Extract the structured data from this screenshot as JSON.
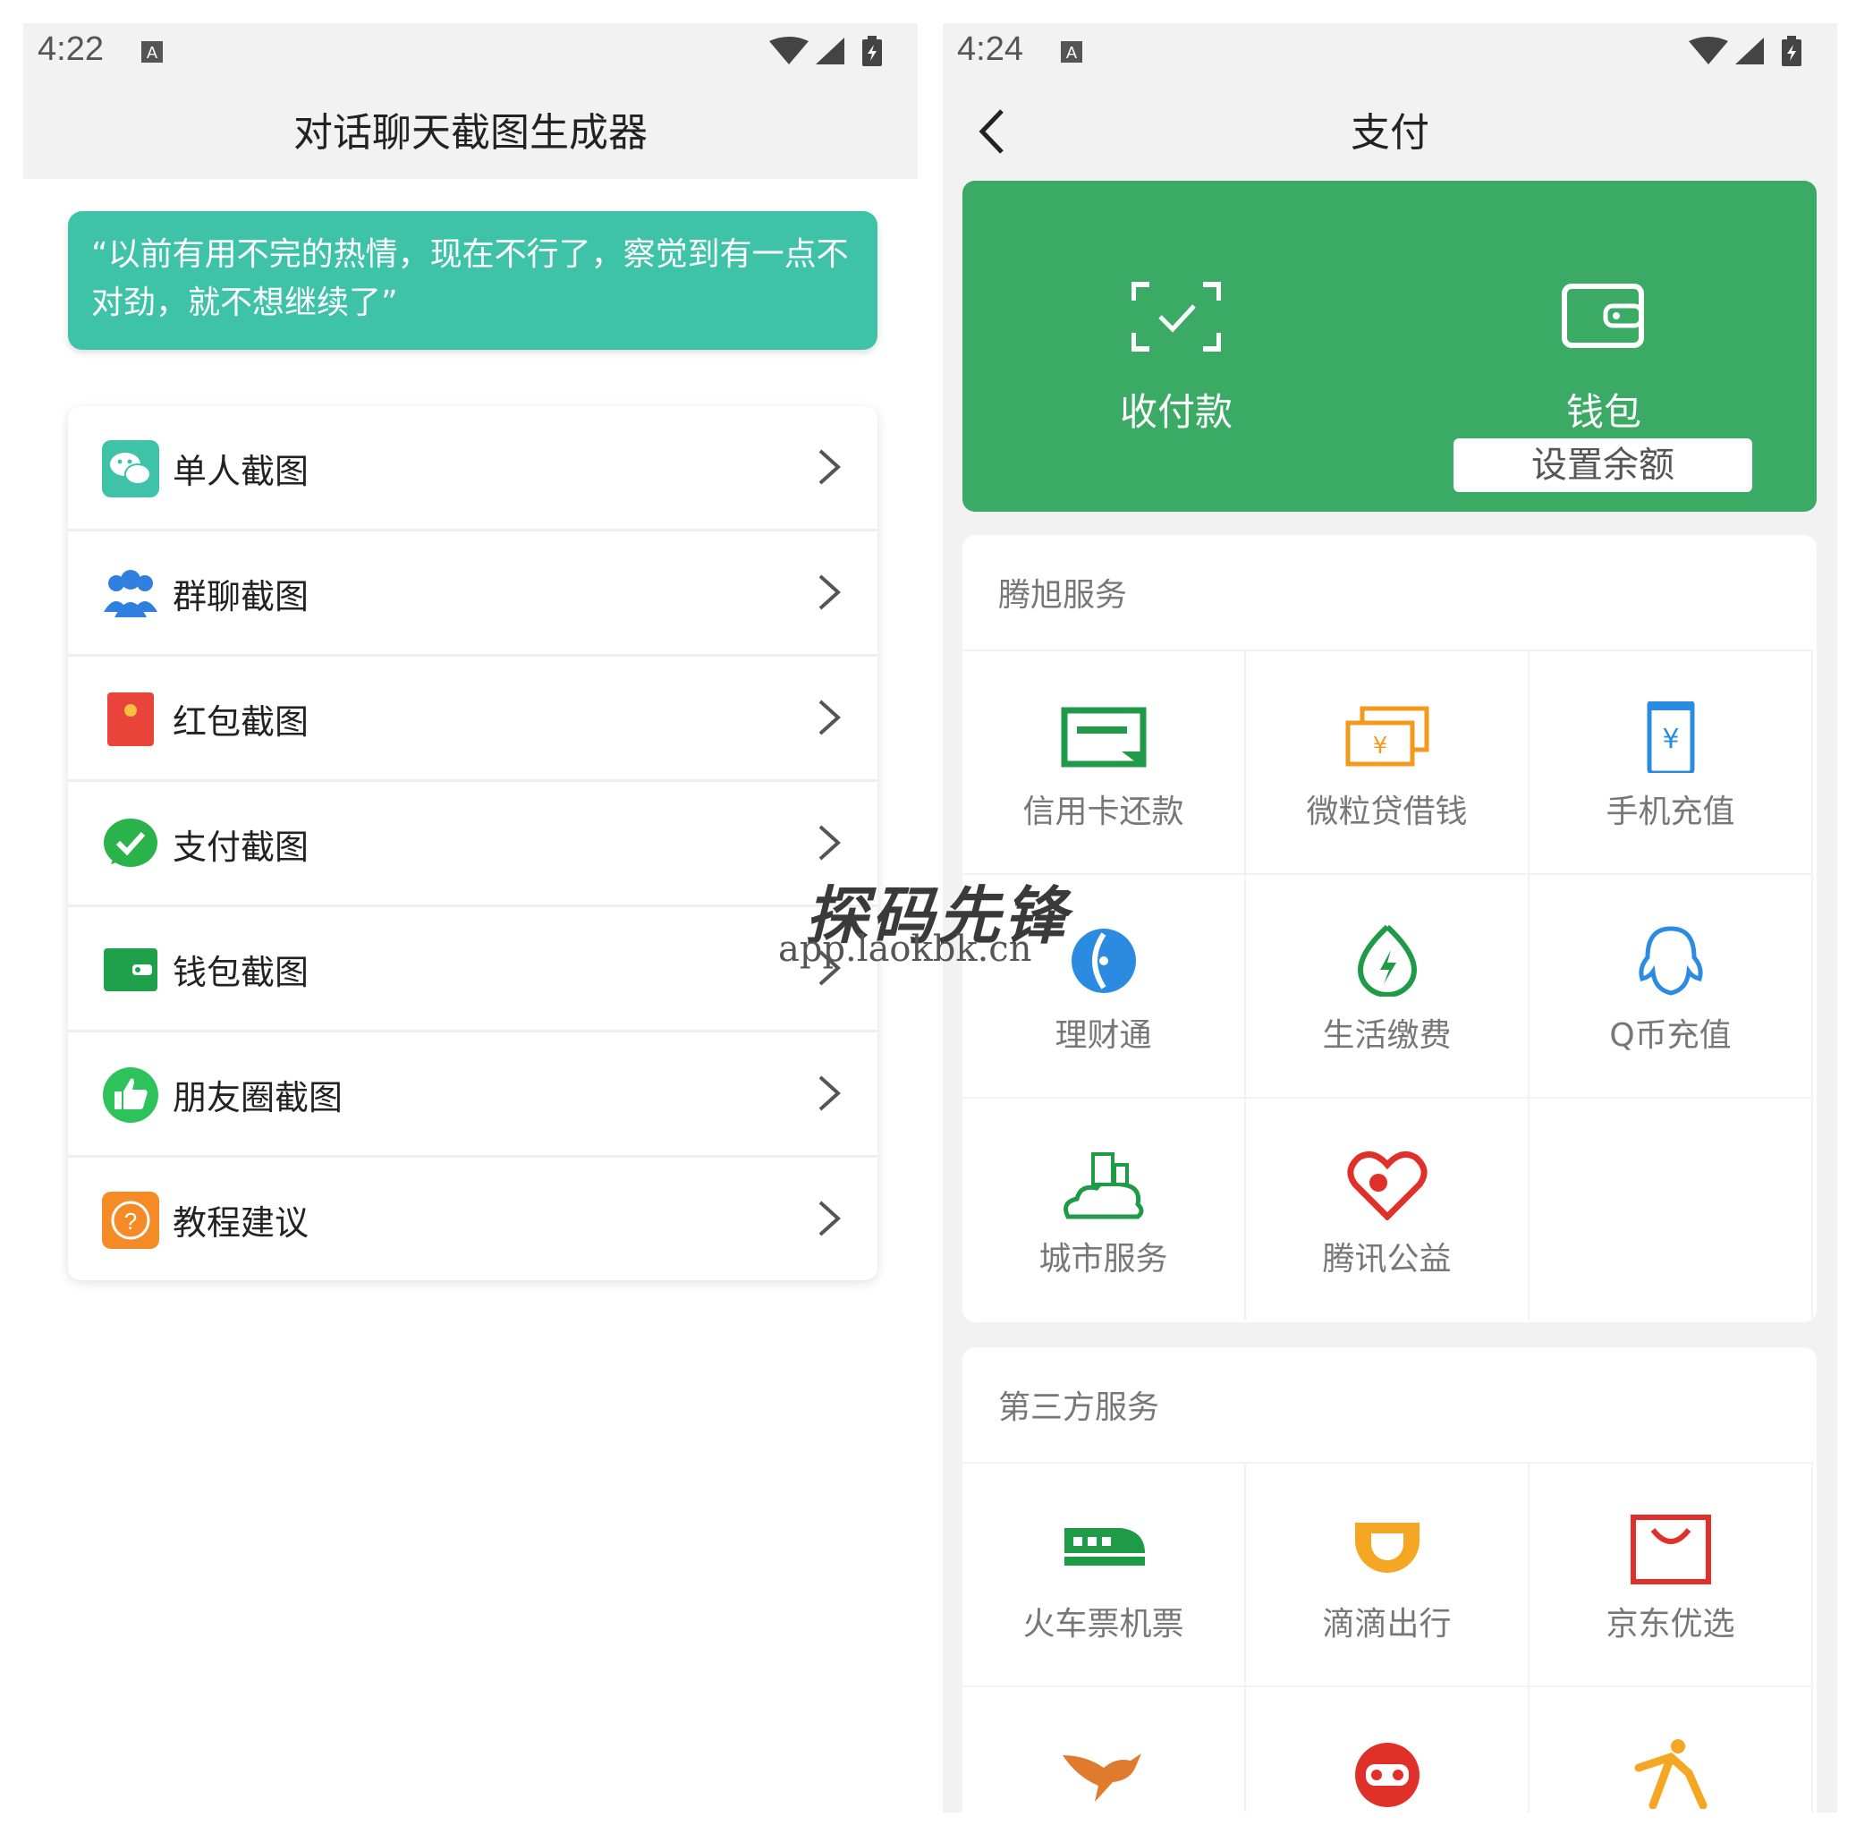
{
  "left": {
    "status_time": "4:22",
    "title": "对话聊天截图生成器",
    "quote": "“以前有用不完的热情，现在不行了，察觉到有一点不对劲，就不想继续了”",
    "menu": [
      {
        "label": "单人截图",
        "icon": "wechat-icon"
      },
      {
        "label": "群聊截图",
        "icon": "group-icon"
      },
      {
        "label": "红包截图",
        "icon": "red-packet-icon"
      },
      {
        "label": "支付截图",
        "icon": "payment-check-icon"
      },
      {
        "label": "钱包截图",
        "icon": "wallet-icon"
      },
      {
        "label": "朋友圈截图",
        "icon": "thumbs-up-icon"
      },
      {
        "label": "教程建议",
        "icon": "help-icon"
      }
    ]
  },
  "right": {
    "status_time": "4:24",
    "title": "支付",
    "pay_label": "收付款",
    "wallet_label": "钱包",
    "set_balance": "设置余额",
    "tencent_header": "腾旭服务",
    "tencent_services": [
      "信用卡还款",
      "微粒贷借钱",
      "手机充值",
      "理财通",
      "生活缴费",
      "Q币充值",
      "城市服务",
      "腾讯公益"
    ],
    "third_header": "第三方服务",
    "third_services": [
      "火车票机票",
      "滴滴出行",
      "京东优选"
    ],
    "colors": {
      "green": "#3aaa64",
      "teal": "#3fc3a8"
    }
  },
  "watermark": {
    "line1": "探码先锋",
    "line2": "app.laokbk.cn"
  }
}
